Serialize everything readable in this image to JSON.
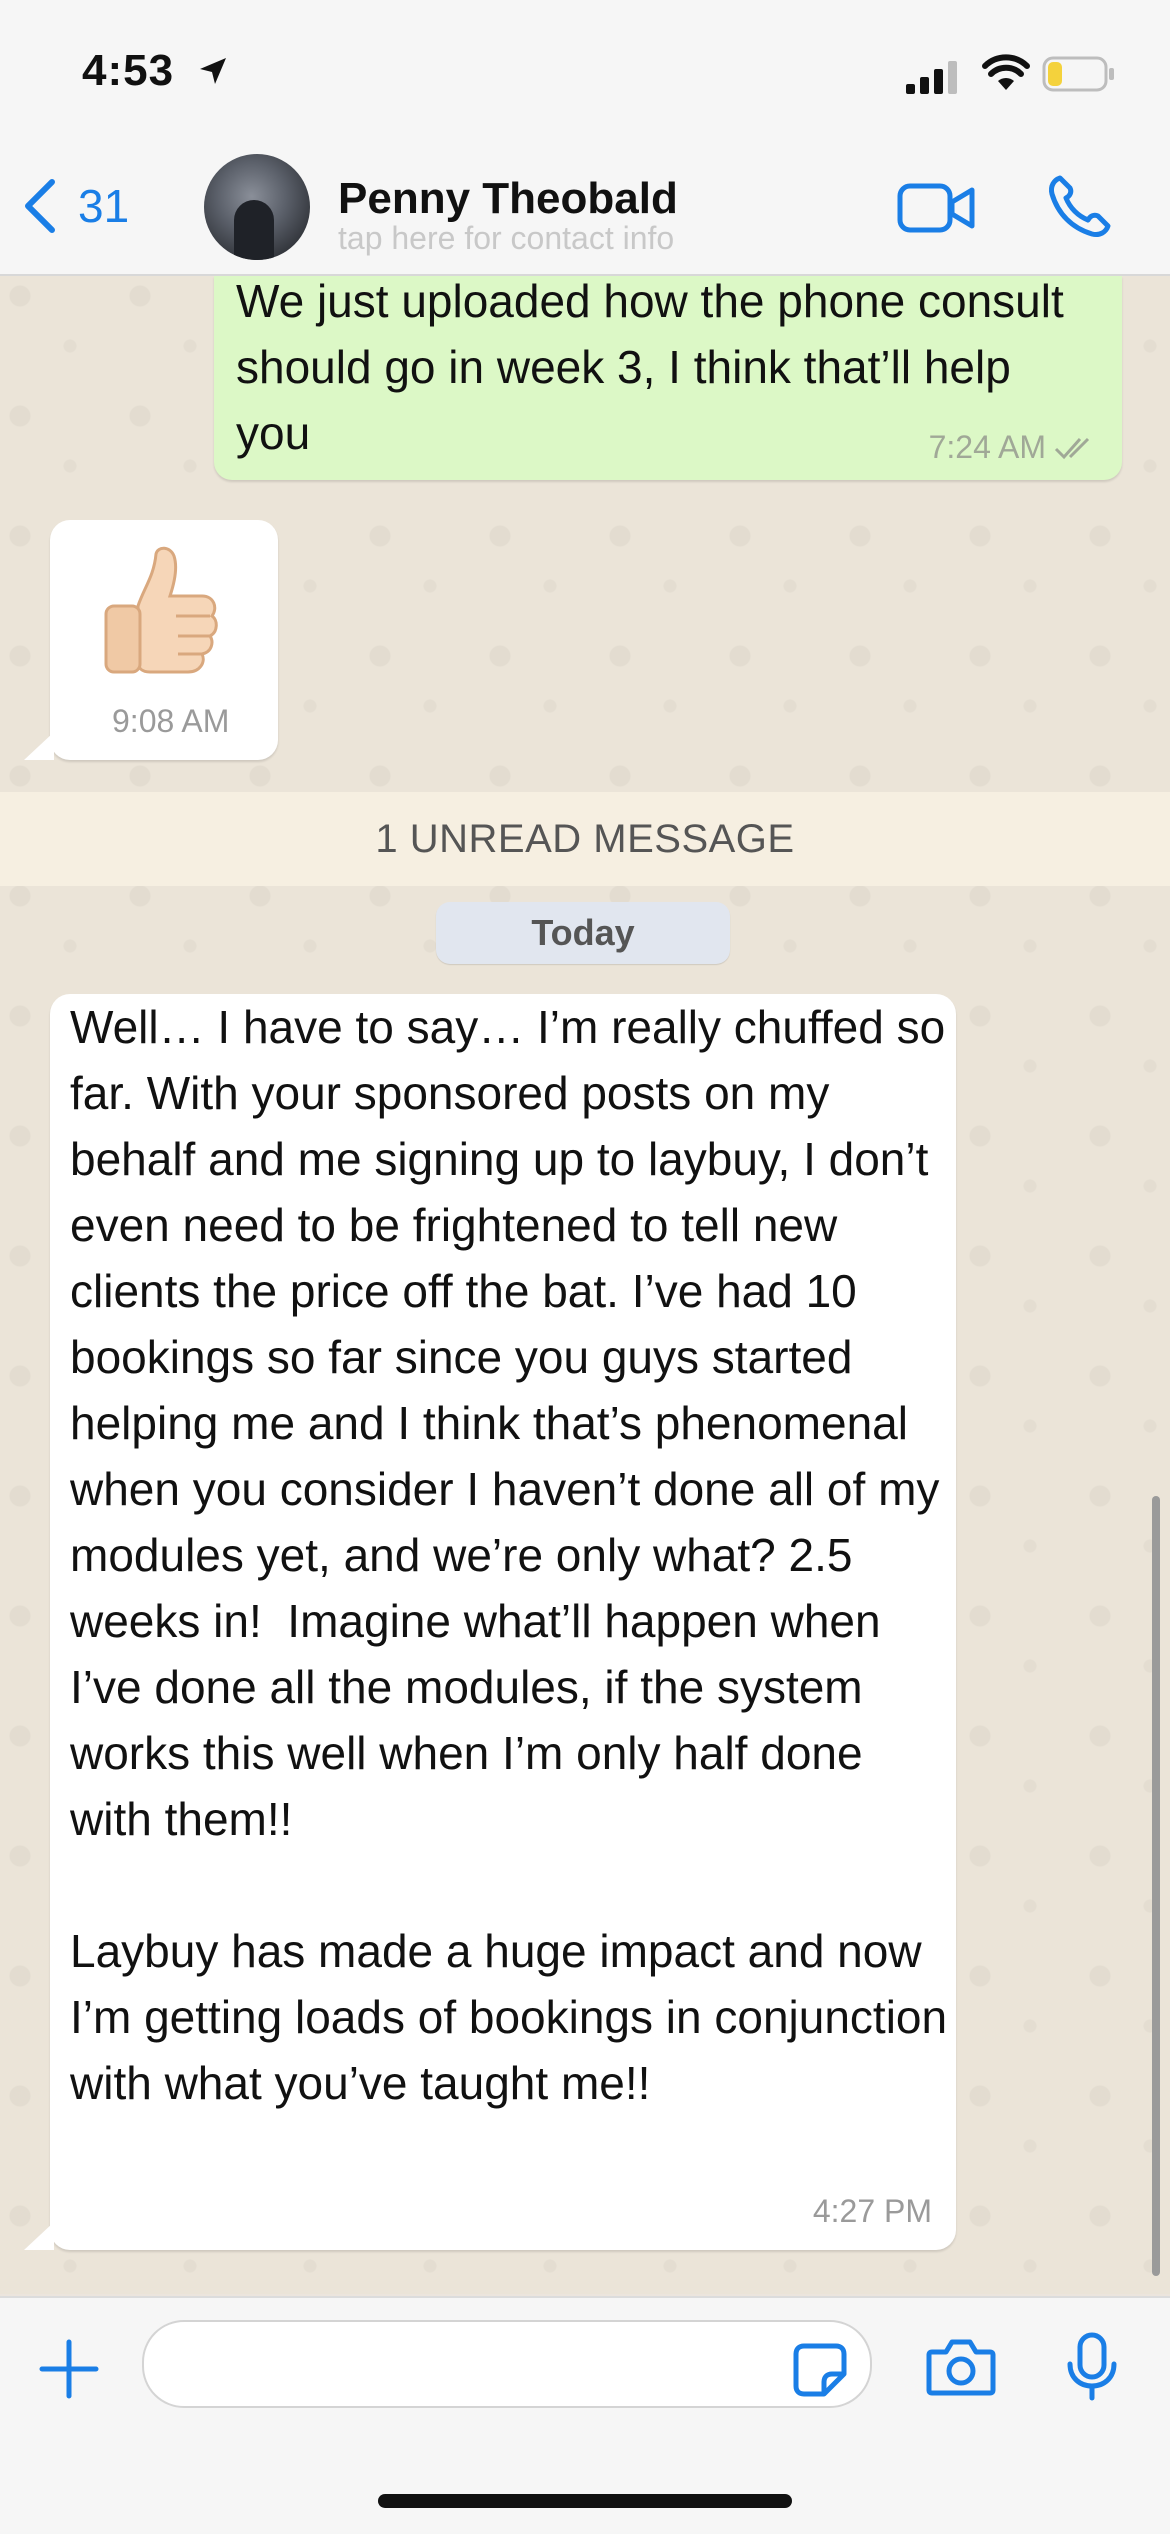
{
  "status_bar": {
    "time": "4:53",
    "icons": [
      "location-arrow-icon",
      "cellular-signal-icon",
      "wifi-icon",
      "battery-icon"
    ]
  },
  "header": {
    "back_count": "31",
    "contact_name": "Penny Theobald",
    "contact_subtitle": "tap here for contact info",
    "icons": [
      "chevron-left-icon",
      "video-call-icon",
      "phone-call-icon"
    ]
  },
  "messages": {
    "outgoing_1": {
      "text": "We just uploaded how the phone consult should go in week 3, I think that’ll help you",
      "time": "7:24 AM",
      "status_icon": "double-check-icon"
    },
    "sticker_1": {
      "emoji": "👍",
      "time": "9:08 AM"
    },
    "unread_banner": "1 UNREAD MESSAGE",
    "date_chip": "Today",
    "incoming_1": {
      "text": "Well… I have to say… I’m really chuffed so far. With your sponsored posts on my behalf and me signing up to laybuy, I don’t even need to be frightened to tell new clients the price off the bat. I’ve had 10 bookings so far since you guys started helping me and I think that’s phenomenal when you consider I haven’t done all of my modules yet, and we’re only what? 2.5 weeks in!  Imagine what’ll happen when I’ve done all the modules, if the system works this well when I’m only half done with them!!\n\nLaybuy has made a huge impact and now I’m getting loads of bookings in conjunction with what you’ve taught me!!",
      "time": "4:27 PM"
    }
  },
  "input_bar": {
    "message_value": "",
    "icons": [
      "plus-icon",
      "sticker-icon",
      "camera-icon",
      "microphone-icon"
    ]
  },
  "colors": {
    "accent": "#1a7ee6",
    "outgoing_bubble": "#dcf8c6",
    "incoming_bubble": "#ffffff",
    "chat_background": "#ebe4d8"
  }
}
